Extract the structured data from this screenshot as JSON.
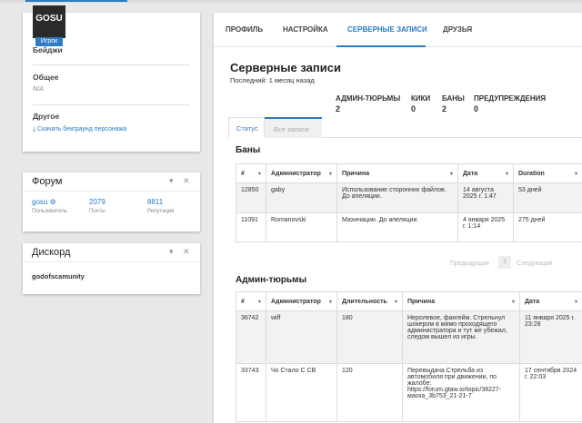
{
  "profile": {
    "avatar_text": "GOSU",
    "role_badge": "Игрок",
    "badges_label": "Бейджи",
    "general_label": "Общее",
    "general_value": "N/A",
    "other_label": "Другое",
    "download_link": "Скачать бекграунд персонажа"
  },
  "forum": {
    "title": "Форум",
    "username": "gosu",
    "user_label": "Пользователь",
    "posts_value": "2079",
    "posts_label": "Посты",
    "rep_value": "8811",
    "rep_label": "Репутация",
    "minimize_icon": "▾",
    "close_icon": "✕"
  },
  "discord": {
    "title": "Дискорд",
    "username": "godofscamunity",
    "minimize_icon": "▾",
    "close_icon": "✕"
  },
  "tabs": [
    "ПРОФИЛЬ",
    "НАСТРОЙКА",
    "СЕРВЕРНЫЕ ЗАПИСИ",
    "ДРУЗЬЯ"
  ],
  "records": {
    "title": "Серверные записи",
    "last_line": "Последний: 1 месяц назад",
    "summary": [
      {
        "label": "АДМИН-ТЮРЬМЫ",
        "value": "2"
      },
      {
        "label": "КИКИ",
        "value": "0"
      },
      {
        "label": "БАНЫ",
        "value": "2"
      },
      {
        "label": "ПРЕДУПРЕЖДЕНИЯ",
        "value": "0"
      }
    ],
    "subtabs": [
      "Статус",
      "Все записи"
    ]
  },
  "bans": {
    "title": "Баны",
    "columns": [
      "#",
      "Администратор",
      "Причина",
      "Дата",
      "Duration"
    ],
    "rows": [
      [
        "12850",
        "gaby",
        "Использование сторонних файлов. До апеляции.",
        "14 августа 2025 г. 1:47",
        "53 дней"
      ],
      [
        "11091",
        "Romanovski",
        "Махинации. До апеляции.",
        "4 января 2025 г. 1:14",
        "275 дней"
      ]
    ],
    "pager": {
      "prev": "Предыдущая",
      "page": "1",
      "next": "Следующая"
    }
  },
  "jails": {
    "title": "Админ-тюрьмы",
    "columns": [
      "#",
      "Администратор",
      "Длительность",
      "Причина",
      "Дата"
    ],
    "rows": [
      [
        "36742",
        "wiff",
        "180",
        "Неролевое, фангейм. Стрельнул шокером в мимо проходящего администратора и тут же убежал, следом вышел из игры.",
        "11 января 2025 г. 23:28"
      ],
      [
        "33743",
        "Чо Стало С СВ",
        "120",
        "Перевыдача Стрельба из автомобиля при движении, по жалобе: https://forum.gtaw.io/topic/38227-маска_3b753_21-21-7",
        "17 сентября 2024 г. 22:03"
      ]
    ]
  },
  "sort_icon": "▾"
}
